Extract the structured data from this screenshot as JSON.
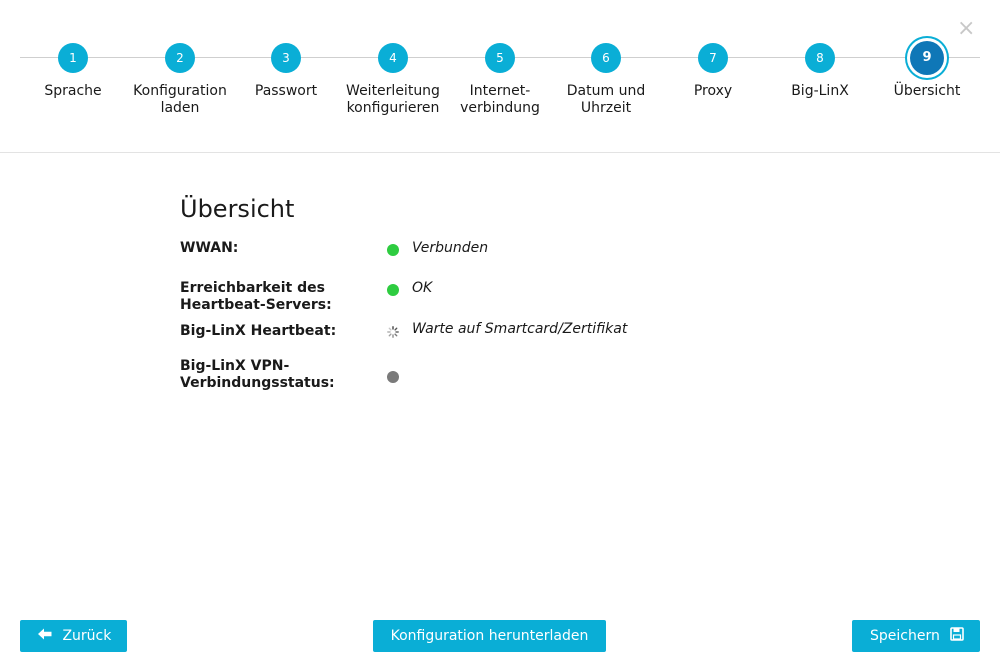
{
  "dialog": {
    "close_symbol": "×"
  },
  "stepper": {
    "steps": [
      {
        "number": "1",
        "label": "Sprache",
        "state": "completed"
      },
      {
        "number": "2",
        "label": "Konfiguration\nladen",
        "state": "completed"
      },
      {
        "number": "3",
        "label": "Passwort",
        "state": "completed"
      },
      {
        "number": "4",
        "label": "Weiterleitung\nkonfigurieren",
        "state": "completed"
      },
      {
        "number": "5",
        "label": "Internet-\nverbindung",
        "state": "completed"
      },
      {
        "number": "6",
        "label": "Datum und\nUhrzeit",
        "state": "completed"
      },
      {
        "number": "7",
        "label": "Proxy",
        "state": "completed"
      },
      {
        "number": "8",
        "label": "Big-LinX",
        "state": "completed"
      },
      {
        "number": "9",
        "label": "Übersicht",
        "state": "active"
      }
    ]
  },
  "overview": {
    "title": "Übersicht",
    "rows": [
      {
        "label": "WWAN:",
        "status": "green",
        "icon": "status-dot-icon",
        "value": "Verbunden"
      },
      {
        "label": "Erreichbarkeit des\nHeartbeat-Servers:",
        "status": "green",
        "icon": "status-dot-icon",
        "value": "OK"
      },
      {
        "label": "Big-LinX Heartbeat:",
        "status": "loading",
        "icon": "spinner-icon",
        "value": "Warte auf Smartcard/Zertifikat"
      },
      {
        "label": "Big-LinX VPN-\nVerbindungsstatus:",
        "status": "gray",
        "icon": "status-dot-icon",
        "value": ""
      }
    ]
  },
  "footer": {
    "back_label": "Zurück",
    "download_label": "Konfiguration herunterladen",
    "save_label": "Speichern"
  },
  "colors": {
    "accent": "#0aaed6",
    "active_step": "#0f77b7",
    "status_green": "#2ecc40",
    "status_gray": "#7a7a7a"
  }
}
